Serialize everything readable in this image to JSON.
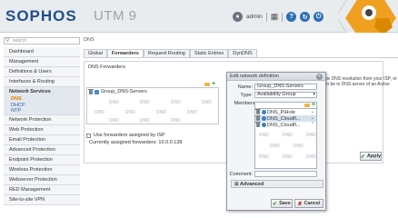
{
  "header": {
    "logo": "SOPHOS",
    "product": "UTM 9",
    "user": "admin",
    "colors": {
      "brand": "#1f4e8c",
      "accent": "#f0a020"
    }
  },
  "search": {
    "placeholder": "search"
  },
  "nav": {
    "items": [
      {
        "label": "Dashboard"
      },
      {
        "label": "Management"
      },
      {
        "label": "Definitions & Users"
      },
      {
        "label": "Interfaces & Routing"
      }
    ],
    "active": {
      "label": "Network Services"
    },
    "subitems": [
      {
        "label": "DNS",
        "selected": true
      },
      {
        "label": "DHCP"
      },
      {
        "label": "NTP"
      }
    ],
    "items_after": [
      {
        "label": "Network Protection"
      },
      {
        "label": "Web Protection"
      },
      {
        "label": "Email Protection"
      },
      {
        "label": "Advanced Protection"
      },
      {
        "label": "Endpoint Protection"
      },
      {
        "label": "Wireless Protection"
      },
      {
        "label": "Webserver Protection"
      },
      {
        "label": "RED Management"
      },
      {
        "label": "Site-to-site VPN"
      }
    ]
  },
  "breadcrumb": "DNS",
  "tabs": [
    {
      "label": "Global"
    },
    {
      "label": "Forwarders",
      "active": true
    },
    {
      "label": "Request Routing"
    },
    {
      "label": "Static Entries"
    },
    {
      "label": "DynDNS"
    }
  ],
  "forwarders": {
    "title": "DNS Forwarders",
    "items": [
      {
        "name": "Group_DNS-Servers"
      }
    ],
    "dnd": "DND",
    "use_isp_label": "Use forwarders assigned by ISP",
    "assigned_label": "Currently assigned forwarders: 10.0.0.138",
    "description": "olve DNS resolution from your ISP, or can be in DNS server of an Active",
    "apply_label": "Apply"
  },
  "dialog": {
    "title": "Edit network definition",
    "name_label": "Name:",
    "name_value": "Group_DNS-Servers",
    "type_label": "Type:",
    "type_value": "Availability Group",
    "members_label": "Members:",
    "members": [
      {
        "name": "DNS_PiHole"
      },
      {
        "name": "DNS_Cloudfl..."
      },
      {
        "name": "DNS_Cloudfl..."
      }
    ],
    "comment_label": "Comment:",
    "advanced_label": "Advanced",
    "save_label": "Save",
    "cancel_label": "Cancel"
  }
}
